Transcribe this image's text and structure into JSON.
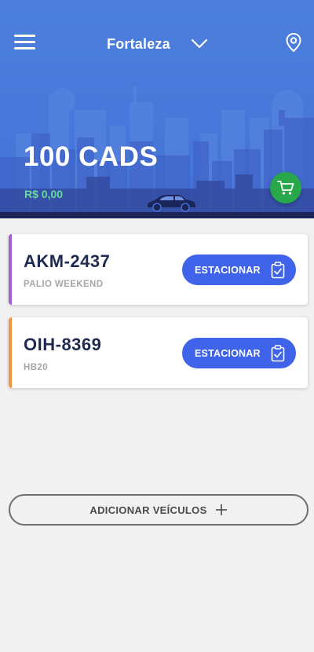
{
  "header": {
    "city": "Fortaleza",
    "cads_title": "100 CADS",
    "balance": "R$ 0,00",
    "icons": {
      "menu": "hamburger-menu-icon",
      "city_dropdown": "chevron-down-icon",
      "location": "location-pin-icon",
      "car": "car-icon",
      "cart": "shopping-cart-icon"
    }
  },
  "vehicles": [
    {
      "plate": "AKM-2437",
      "model": "PALIO WEEKEND",
      "action_label": "ESTACIONAR",
      "accent_color": "#a35fd3"
    },
    {
      "plate": "OIH-8369",
      "model": "HB20",
      "action_label": "ESTACIONAR",
      "accent_color": "#f29740"
    }
  ],
  "add_vehicle_label": "ADICIONAR VEÍCULOS",
  "colors": {
    "header_blue": "#4d7fde",
    "primary_button": "#3f63e9",
    "cart_green": "#28a74b",
    "balance_green": "#67d9a0",
    "plate_text": "#1f2a52"
  }
}
